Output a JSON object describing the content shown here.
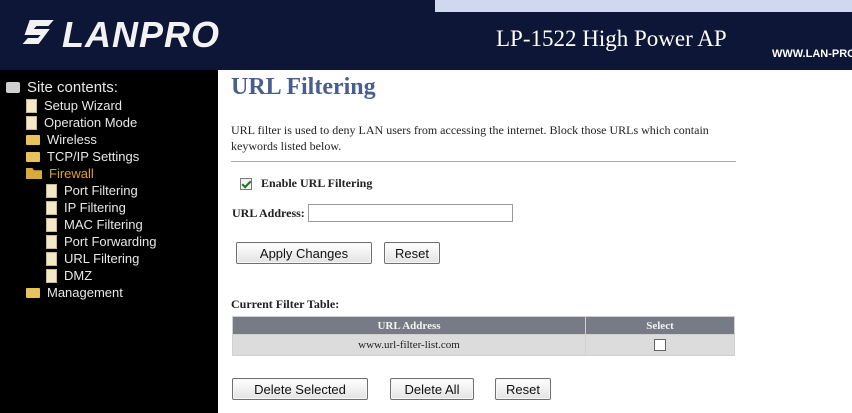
{
  "header": {
    "logo_text": "LANPRO",
    "product_title": "LP-1522 High Power AP",
    "site_url": "WWW.LAN-PRO"
  },
  "sidebar": {
    "root_label": "Site contents:",
    "items": [
      {
        "label": "Setup Wizard",
        "icon": "document-icon"
      },
      {
        "label": "Operation Mode",
        "icon": "document-icon"
      },
      {
        "label": "Wireless",
        "icon": "folder-icon"
      },
      {
        "label": "TCP/IP Settings",
        "icon": "folder-icon"
      },
      {
        "label": "Firewall",
        "icon": "folder-open-icon",
        "active": true
      },
      {
        "label": "Port Filtering",
        "icon": "document-icon"
      },
      {
        "label": "IP Filtering",
        "icon": "document-icon"
      },
      {
        "label": "MAC Filtering",
        "icon": "document-icon"
      },
      {
        "label": "Port Forwarding",
        "icon": "document-icon"
      },
      {
        "label": "URL Filtering",
        "icon": "document-icon"
      },
      {
        "label": "DMZ",
        "icon": "document-icon"
      },
      {
        "label": "Management",
        "icon": "folder-icon"
      }
    ]
  },
  "main": {
    "title": "URL Filtering",
    "description": "URL filter is used to deny LAN users from accessing the internet. Block those URLs which contain keywords listed below.",
    "enable_label": "Enable URL Filtering",
    "enable_checked": true,
    "url_label": "URL Address:",
    "url_value": "",
    "apply_label": "Apply Changes",
    "reset_label": "Reset"
  },
  "filter_table": {
    "section_label": "Current Filter Table:",
    "columns": [
      "URL Address",
      "Select"
    ],
    "rows": [
      {
        "url": "www.url-filter-list.com",
        "selected": false
      }
    ],
    "delete_selected_label": "Delete Selected",
    "delete_all_label": "Delete All",
    "reset_label": "Reset"
  },
  "colors": {
    "header_bg": "#0d1636",
    "sidebar_bg": "#000000",
    "title_color": "#4a5e8e",
    "active_item": "#e0a21a",
    "table_header_bg": "#767b85",
    "table_row_bg": "#dcdcdc"
  }
}
